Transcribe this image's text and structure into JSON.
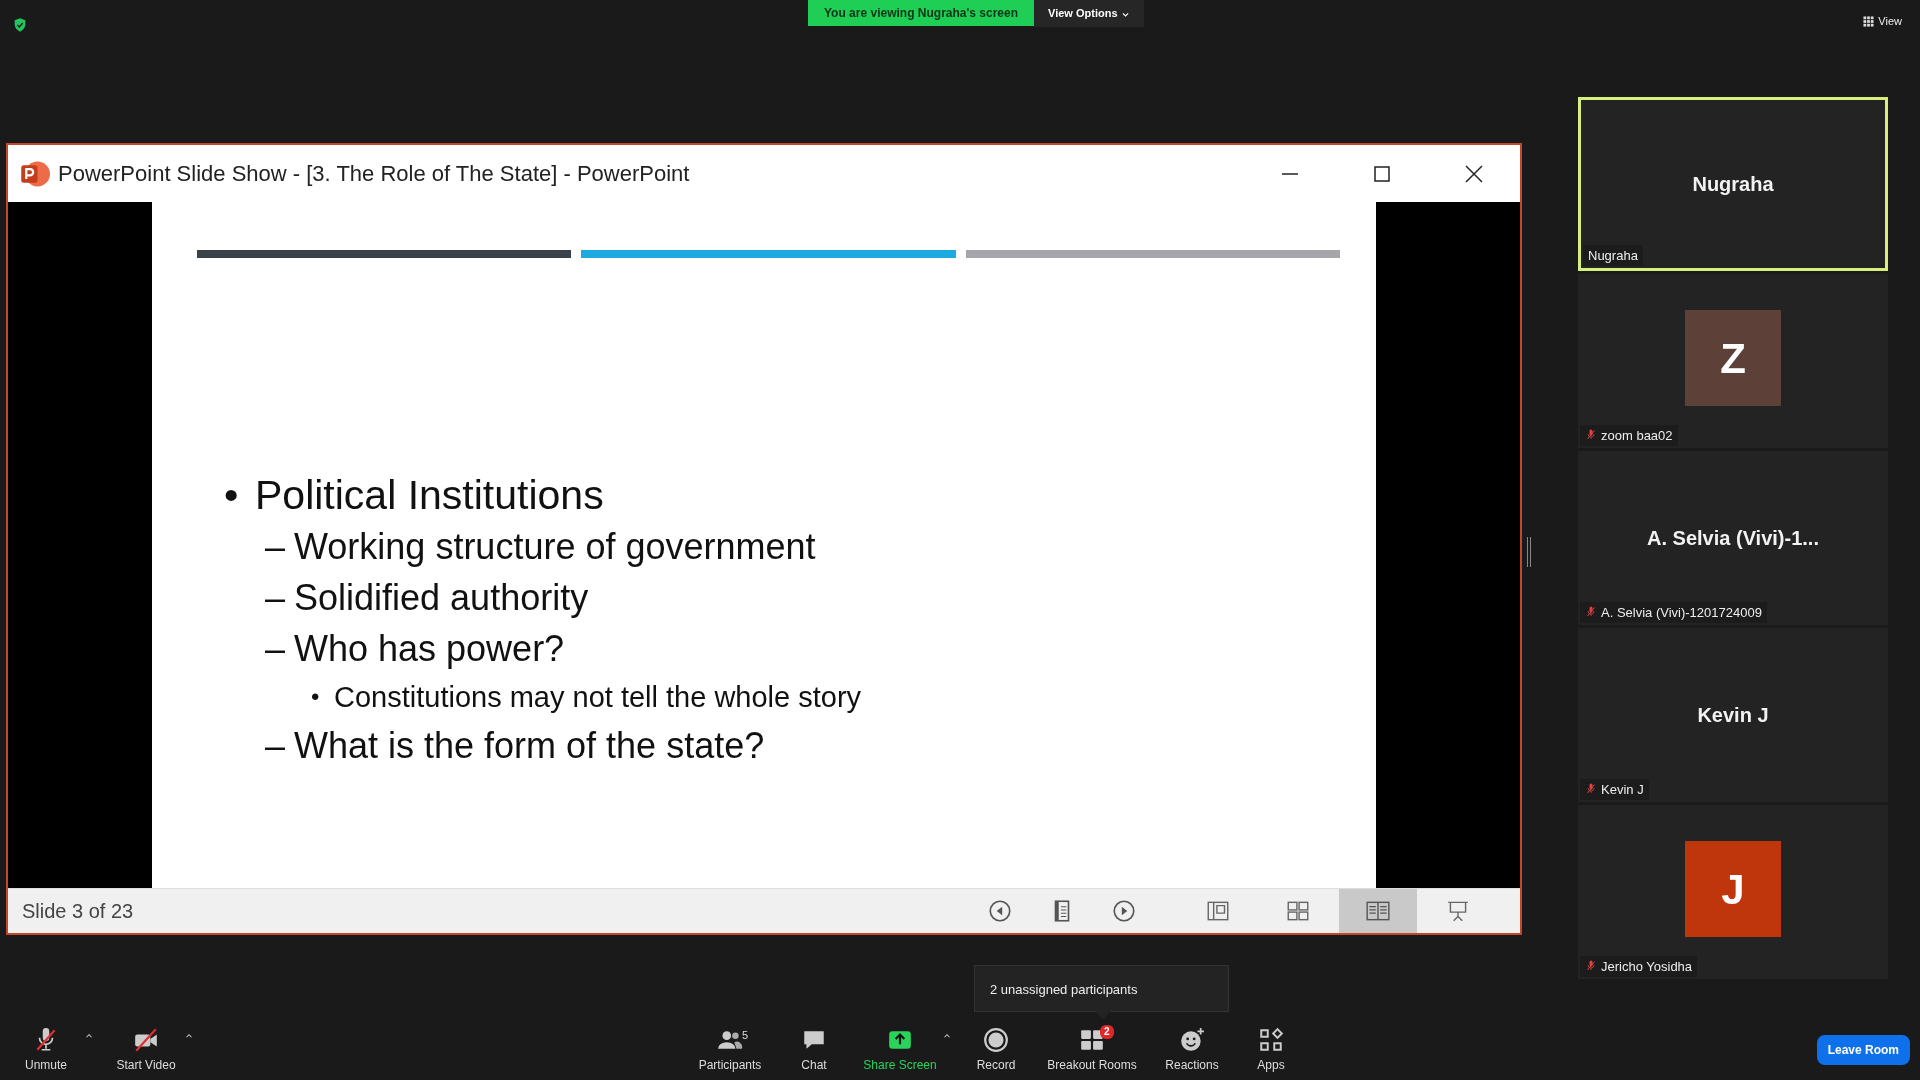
{
  "top_bar": {
    "banner": "You are viewing Nugraha's screen",
    "view_options": "View Options",
    "view": "View"
  },
  "shared_window": {
    "title": "PowerPoint Slide Show - [3. The Role of The State] - PowerPoint",
    "slide": {
      "bars": [
        {
          "color": "#3a4249"
        },
        {
          "color": "#1fa9e1"
        },
        {
          "color": "#a5a5aa"
        }
      ],
      "bullets": [
        {
          "marker": "•",
          "text": "Political Institutions",
          "children": [
            {
              "marker": "–",
              "text": "Working structure of government"
            },
            {
              "marker": "–",
              "text": "Solidified authority"
            },
            {
              "marker": "–",
              "text": "Who has power?",
              "children": [
                {
                  "marker": "•",
                  "text": "Constitutions may not tell the whole story"
                }
              ]
            },
            {
              "marker": "–",
              "text": "What is the form of the state?"
            }
          ]
        }
      ]
    },
    "status": "Slide 3 of 23",
    "nav_buttons": [
      {
        "kind": "previous"
      },
      {
        "kind": "notes"
      },
      {
        "kind": "next"
      }
    ],
    "view_buttons": [
      {
        "kind": "normal",
        "selected": false
      },
      {
        "kind": "sorter",
        "selected": false
      },
      {
        "kind": "reading",
        "selected": true
      },
      {
        "kind": "slideshow",
        "selected": false
      }
    ]
  },
  "participants": [
    {
      "kind": "name",
      "display": "Nugraha",
      "label": "Nugraha",
      "speaking": true,
      "muted": false
    },
    {
      "kind": "avatar",
      "display": "Z",
      "color": "#5d4037",
      "label": "zoom baa02",
      "speaking": false,
      "muted": true
    },
    {
      "kind": "name",
      "display": "A. Selvia  (Vivi)-1...",
      "label": "A. Selvia (Vivi)-1201724009",
      "speaking": false,
      "muted": true
    },
    {
      "kind": "name",
      "display": "Kevin J",
      "label": "Kevin J",
      "speaking": false,
      "muted": true
    },
    {
      "kind": "avatar",
      "display": "J",
      "color": "#bf360c",
      "label": "Jericho Yosidha",
      "speaking": false,
      "muted": true
    }
  ],
  "tooltip": "2 unassigned participants",
  "toolbar": {
    "left": [
      {
        "kind": "mic-off",
        "label": "Unmute",
        "caret": true
      },
      {
        "kind": "video-off",
        "label": "Start Video",
        "caret": true
      }
    ],
    "center": [
      {
        "kind": "participants",
        "label": "Participants",
        "count": "5",
        "caret": false
      },
      {
        "kind": "chat",
        "label": "Chat",
        "caret": false
      },
      {
        "kind": "share",
        "label": "Share Screen",
        "caret": true
      },
      {
        "kind": "record",
        "label": "Record",
        "caret": false
      },
      {
        "kind": "breakout",
        "label": "Breakout Rooms",
        "badge": "2",
        "caret": false
      },
      {
        "kind": "reactions",
        "label": "Reactions",
        "caret": false
      },
      {
        "kind": "apps",
        "label": "Apps",
        "caret": false
      }
    ],
    "leave": "Leave Room"
  }
}
